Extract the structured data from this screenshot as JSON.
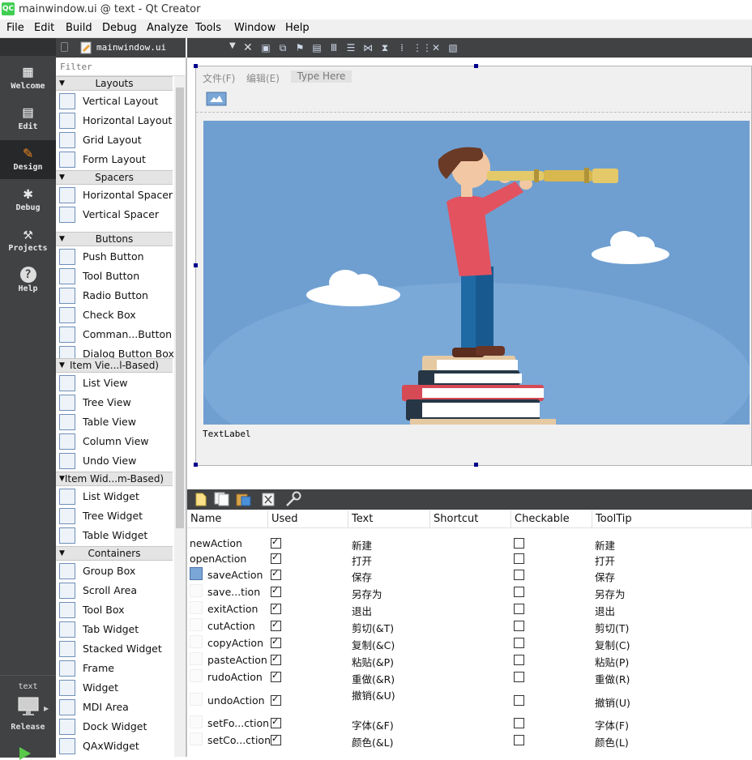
{
  "window": {
    "title": "mainwindow.ui @ text - Qt Creator",
    "logo_text": "QC"
  },
  "menubar": [
    "File",
    "Edit",
    "Build",
    "Debug",
    "Analyze",
    "Tools",
    "Window",
    "Help"
  ],
  "modes": [
    {
      "label": "Welcome",
      "icon": "grid-icon"
    },
    {
      "label": "Edit",
      "icon": "document-icon"
    },
    {
      "label": "Design",
      "icon": "pencil-icon"
    },
    {
      "label": "Debug",
      "icon": "bug-icon"
    },
    {
      "label": "Projects",
      "icon": "wrench-icon"
    },
    {
      "label": "Help",
      "icon": "question-icon"
    }
  ],
  "active_mode": "Design",
  "kit": {
    "project": "text",
    "build": "Release"
  },
  "editor": {
    "file": "mainwindow.ui"
  },
  "widgetbox": {
    "filter_placeholder": "Filter",
    "categories": [
      {
        "name": "Layouts",
        "items": [
          "Vertical Layout",
          "Horizontal Layout",
          "Grid Layout",
          "Form Layout"
        ]
      },
      {
        "name": "Spacers",
        "items": [
          "Horizontal Spacer",
          "Vertical Spacer"
        ]
      },
      {
        "name": "Buttons",
        "items": [
          "Push Button",
          "Tool Button",
          "Radio Button",
          "Check Box",
          "Comman...Button",
          "Dialog Button Box"
        ]
      },
      {
        "name": "Item Vie...l-Based)",
        "items": [
          "List View",
          "Tree View",
          "Table View",
          "Column View",
          "Undo View"
        ]
      },
      {
        "name": "Item Wid...m-Based)",
        "items": [
          "List Widget",
          "Tree Widget",
          "Table Widget"
        ]
      },
      {
        "name": "Containers",
        "items": [
          "Group Box",
          "Scroll Area",
          "Tool Box",
          "Tab Widget",
          "Stacked Widget",
          "Frame",
          "Widget",
          "MDI Area",
          "Dock Widget",
          "QAxWidget"
        ]
      }
    ]
  },
  "form": {
    "menus": [
      "文件(F)",
      "编辑(E)"
    ],
    "type_here": "Type Here",
    "label_text": "TextLabel"
  },
  "action_editor": {
    "columns": [
      "Name",
      "Used",
      "Text",
      "Shortcut",
      "Checkable",
      "ToolTip"
    ],
    "rows": [
      {
        "name": "newAction",
        "used": true,
        "text": "新建",
        "shortcut": "",
        "checkable": false,
        "tooltip": "新建"
      },
      {
        "name": "openAction",
        "used": true,
        "text": "打开",
        "shortcut": "",
        "checkable": false,
        "tooltip": "打开"
      },
      {
        "name": "saveAction",
        "used": true,
        "text": "保存",
        "shortcut": "",
        "checkable": false,
        "tooltip": "保存"
      },
      {
        "name": "save...tion",
        "used": true,
        "text": "另存为",
        "shortcut": "",
        "checkable": false,
        "tooltip": "另存为"
      },
      {
        "name": "exitAction",
        "used": true,
        "text": "退出",
        "shortcut": "",
        "checkable": false,
        "tooltip": "退出"
      },
      {
        "name": "cutAction",
        "used": true,
        "text": "剪切(&T)",
        "shortcut": "",
        "checkable": false,
        "tooltip": "剪切(T)"
      },
      {
        "name": "copyAction",
        "used": true,
        "text": "复制(&C)",
        "shortcut": "",
        "checkable": false,
        "tooltip": "复制(C)"
      },
      {
        "name": "pasteAction",
        "used": true,
        "text": "粘贴(&P)",
        "shortcut": "",
        "checkable": false,
        "tooltip": "粘贴(P)"
      },
      {
        "name": "rudoAction",
        "used": true,
        "text": "重做(&R)",
        "shortcut": "",
        "checkable": false,
        "tooltip": "重做(R)"
      },
      {
        "name": "undoAction",
        "used": true,
        "text": "撤销(&U)",
        "shortcut": "",
        "checkable": false,
        "tooltip": "撤销(U)"
      },
      {
        "name": "setFo...ction",
        "used": true,
        "text": "字体(&F)",
        "shortcut": "",
        "checkable": false,
        "tooltip": "字体(F)"
      },
      {
        "name": "setCo...ction",
        "used": true,
        "text": "颜色(&L)",
        "shortcut": "",
        "checkable": false,
        "tooltip": "颜色(L)"
      }
    ]
  },
  "colors": {
    "dark_panel": "#404244",
    "active_mode": "#262829",
    "picture_sky": "#6e9fd1",
    "selection_handle": "#00008b"
  }
}
